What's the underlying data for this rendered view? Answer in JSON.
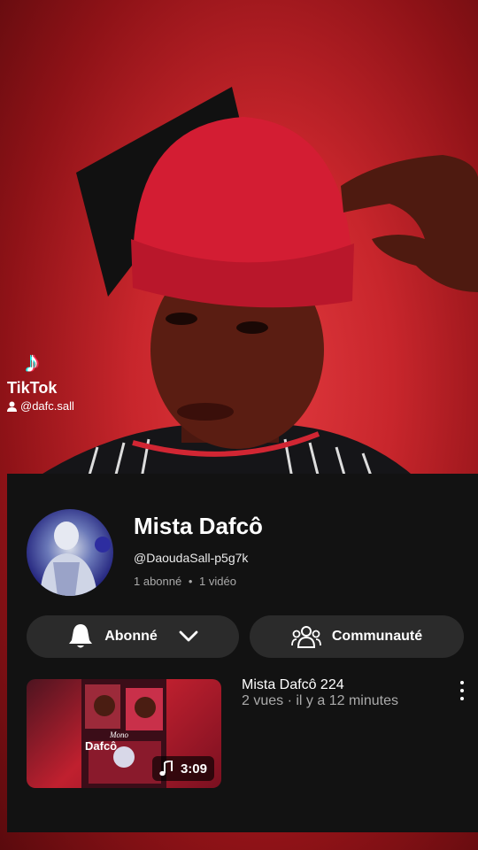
{
  "watermark": {
    "brand": "TikTok",
    "username": "@dafc.sall"
  },
  "channel": {
    "name": "Mista Dafcô",
    "handle": "@DaoudaSall-p5g7k",
    "subscribers": "1 abonné",
    "separator": "•",
    "videos": "1 vidéo"
  },
  "buttons": {
    "subscribe_label": "Abonné",
    "community_label": "Communauté"
  },
  "video": {
    "title": "Mista Dafcô 224",
    "meta": "2 vues · il y a 12 minutes",
    "duration": "3:09",
    "thumb_texts": [
      "Dafcô",
      "Mono"
    ]
  },
  "colors": {
    "background_red": "#c8262c",
    "sheet": "#121212",
    "pill": "#2b2b2b"
  },
  "icons": [
    "tiktok-logo-icon",
    "user-icon",
    "bell-icon",
    "chevron-down-icon",
    "community-icon",
    "music-note-icon",
    "more-vertical-icon"
  ]
}
